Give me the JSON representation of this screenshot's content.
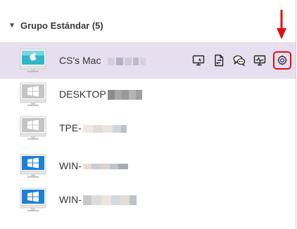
{
  "group": {
    "label": "Grupo Estándar (5)",
    "expanded": true
  },
  "devices": [
    {
      "name": "CS's Mac",
      "os": "mac",
      "selected": true
    },
    {
      "name": "DESKTOP",
      "os": "windows",
      "online": false
    },
    {
      "name": "TPE-",
      "os": "windows",
      "online": false
    },
    {
      "name": "WIN-",
      "os": "windows",
      "online": true
    },
    {
      "name": "WIN-",
      "os": "windows",
      "online": true
    }
  ],
  "actions": [
    {
      "icon": "remote-desktop-icon"
    },
    {
      "icon": "file-transfer-icon"
    },
    {
      "icon": "chat-icon"
    },
    {
      "icon": "system-monitor-icon"
    },
    {
      "icon": "settings-gear-icon",
      "highlighted": true
    }
  ],
  "colors": {
    "selected_row": "#e7def0",
    "highlight": "#e01010",
    "windows_online": "#1e7fd6",
    "windows_offline": "#b8b8b8"
  }
}
